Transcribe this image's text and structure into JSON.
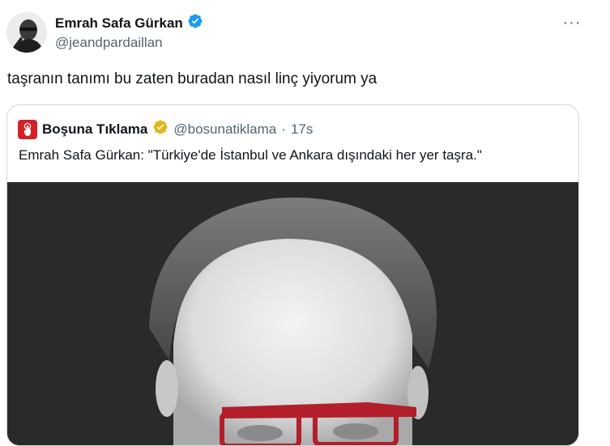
{
  "author": {
    "name": "Emrah Safa Gürkan",
    "handle": "@jeandpardaillan",
    "verified_icon": "verified-badge-icon"
  },
  "more_icon": "more-horizontal-icon",
  "more_label": "···",
  "tweet": {
    "text": "taşranın tanımı bu zaten buradan nasıl linç yiyorum ya"
  },
  "quote": {
    "name": "Boşuna Tıklama",
    "handle": "@bosunatiklama",
    "dot": "·",
    "time": "17s",
    "text": "Emrah Safa Gürkan: \"Türkiye'de İstanbul ve Ankara dışındaki her yer taşra.\"",
    "badge_icon": "gold-verified-badge-icon",
    "avatar_icon": "pointer-hand-icon"
  },
  "colors": {
    "verified_blue": "#1d9bf0",
    "verified_gold": "#e2b719",
    "brand_red": "#d42027"
  }
}
